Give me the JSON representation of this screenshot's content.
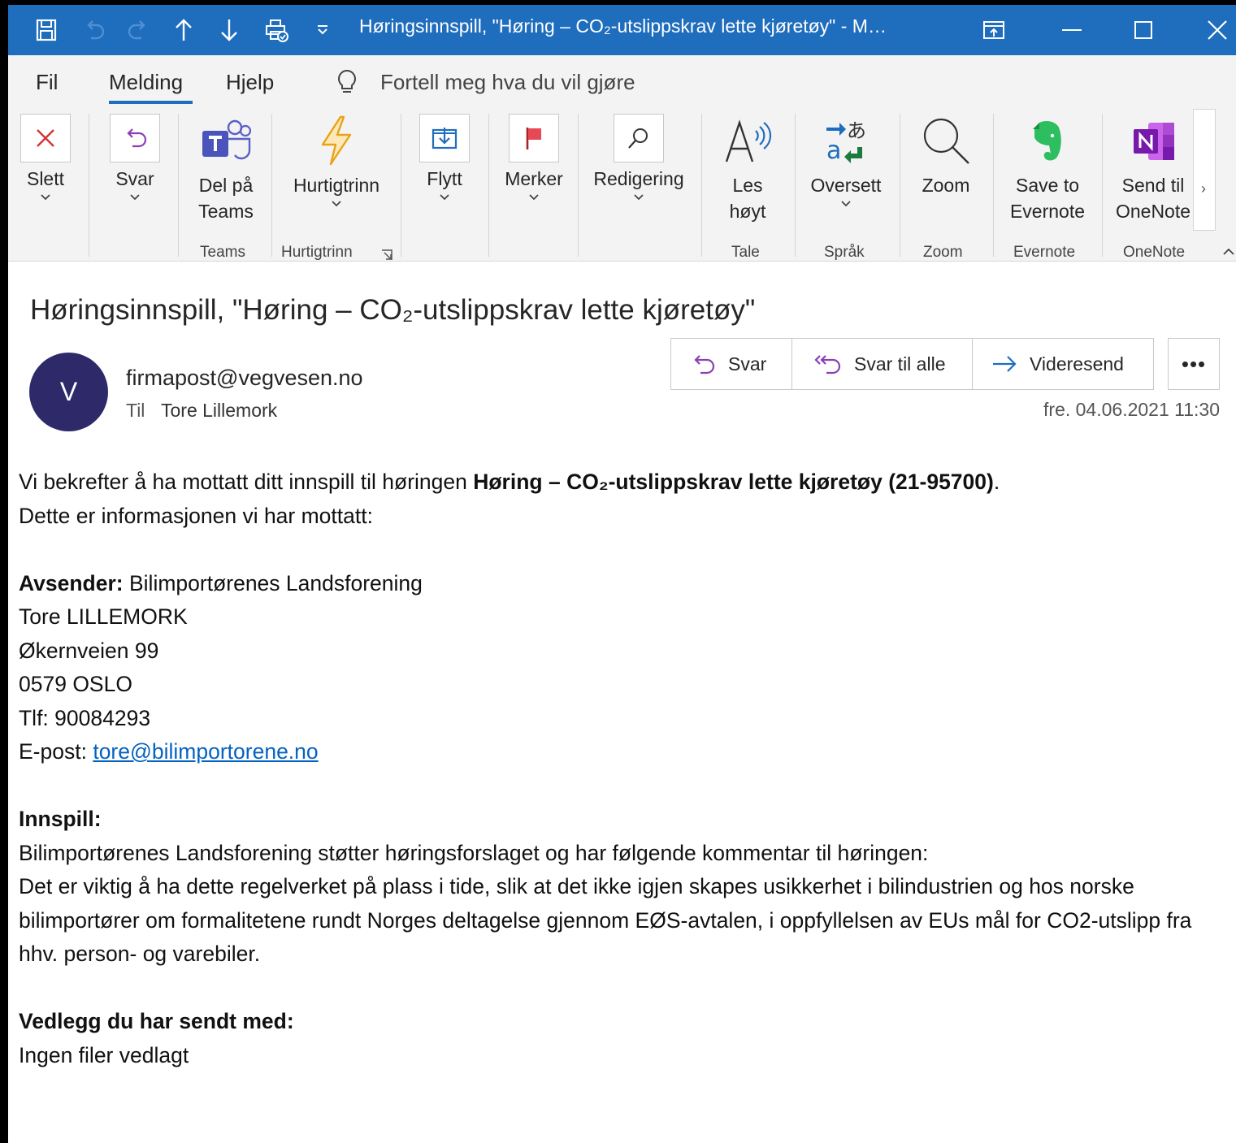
{
  "titlebar": {
    "title": "Høringsinnspill, \"Høring – CO₂-utslippskrav lette kjøretøy\"  -  M…",
    "bg_color": "#1f6dbd",
    "icons": [
      "save-icon",
      "undo-icon",
      "redo-icon",
      "arrow-up-icon",
      "arrow-down-icon",
      "print-options-icon",
      "customize-toolbar-icon"
    ]
  },
  "menu": {
    "tabs": [
      "Fil",
      "Melding",
      "Hjelp"
    ],
    "active_tab": "Melding",
    "tell_me": "Fortell meg hva du vil gjøre"
  },
  "ribbon": {
    "delete": "Slett",
    "reply": "Svar",
    "teams_line1": "Del på",
    "teams_line2": "Teams",
    "quicksteps": "Hurtigtrinn",
    "move": "Flytt",
    "tags": "Merker",
    "editing": "Redigering",
    "read_line1": "Les",
    "read_line2": "høyt",
    "translate": "Oversett",
    "zoom": "Zoom",
    "evernote_line1": "Save to",
    "evernote_line2": "Evernote",
    "onenote_line1": "Send til",
    "onenote_line2": "OneNote",
    "groups": {
      "teams": "Teams",
      "quicksteps": "Hurtigtrinn",
      "speech": "Tale",
      "language": "Språk",
      "zoom": "Zoom",
      "evernote": "Evernote",
      "onenote": "OneNote"
    }
  },
  "message": {
    "subject": "Høringsinnspill, \"Høring – CO₂-utslippskrav lette kjøretøy\"",
    "avatar_letter": "V",
    "avatar_color": "#2e2a6a",
    "sender": "firmapost@vegvesen.no",
    "to_label": "Til",
    "to_name": "Tore Lillemork",
    "date": "fre. 04.06.2021 11:30",
    "actions": {
      "reply": "Svar",
      "reply_all": "Svar til alle",
      "forward": "Videresend",
      "more": "•••"
    }
  },
  "body": {
    "intro_pre": "Vi bekrefter å ha mottatt ditt innspill til høringen ",
    "intro_bold": "Høring – CO₂-utslippskrav lette kjøretøy (21-95700)",
    "intro_post": ".",
    "intro_line2": "Dette er informasjonen vi har mottatt:",
    "sender_label": "Avsender:",
    "sender_org": " Bilimportørenes Landsforening",
    "sender_name": "Tore LILLEMORK",
    "sender_street": "Økernveien 99",
    "sender_city": "0579 OSLO",
    "sender_phone": "Tlf: 90084293",
    "email_label": "E-post: ",
    "email_link": "tore@bilimportorene.no",
    "input_label": "Innspill:",
    "input_line1": "Bilimportørenes Landsforening støtter høringsforslaget og har følgende kommentar til høringen:",
    "input_para": "Det er viktig å ha dette regelverket på plass i tide, slik at det ikke igjen skapes usikkerhet i bilindustrien og hos norske bilimportører om formalitetene rundt Norges deltagelse gjennom EØS-avtalen, i oppfyllelsen av EUs mål for CO2-utslipp fra hhv. person- og varebiler.",
    "attach_label": "Vedlegg du har sendt med:",
    "attach_value": "Ingen filer vedlagt"
  }
}
